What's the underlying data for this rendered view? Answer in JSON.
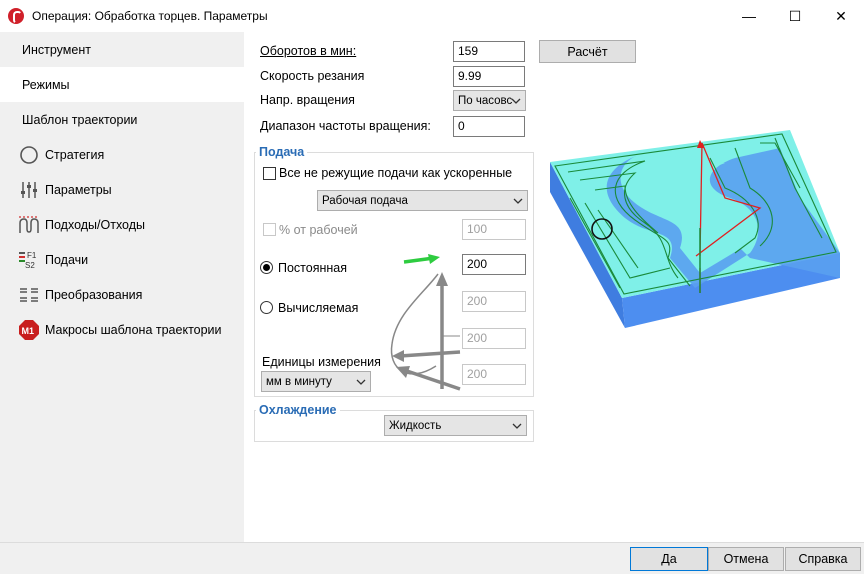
{
  "window": {
    "title": "Операция: Обработка торцев. Параметры",
    "min_glyph": "—",
    "max_glyph": "☐",
    "close_glyph": "✕"
  },
  "sidebar": {
    "items": [
      {
        "label": "Инструмент",
        "icon": null
      },
      {
        "label": "Режимы",
        "icon": null,
        "selected": true
      },
      {
        "label": "Шаблон траектории",
        "icon": null
      },
      {
        "label": "Стратегия",
        "icon": "compass-icon"
      },
      {
        "label": "Параметры",
        "icon": "sliders-icon"
      },
      {
        "label": "Подходы/Отходы",
        "icon": "approach-retract-icon"
      },
      {
        "label": "Подачи",
        "icon": "feeds-icon",
        "icon_text": "F1\nS2"
      },
      {
        "label": "Преобразования",
        "icon": "transform-icon"
      },
      {
        "label": "Макросы шаблона траектории",
        "icon": "macro-icon",
        "icon_text": "M1"
      }
    ]
  },
  "spindle": {
    "rpm_label": "Оборотов в мин:",
    "rpm_value": "159",
    "calc_button": "Расчёт",
    "cutting_speed_label": "Скорость резания",
    "cutting_speed_value": "9.99",
    "rotation_dir_label": "Напр. вращения",
    "rotation_dir_value": "По часовс",
    "freq_range_label": "Диапазон частоты вращения:",
    "freq_range_value": "0"
  },
  "feed": {
    "group_title": "Подача",
    "rapid_checkbox_label": "Все не режущие подачи как ускоренные",
    "feed_type_value": "Рабочая подача",
    "percent_label": "% от рабочей",
    "percent_value": "100",
    "constant_label": "Постоянная",
    "constant_value": "200",
    "computed_label": "Вычисляемая",
    "computed_values": [
      "200",
      "200",
      "200"
    ],
    "units_label": "Единицы измерения",
    "units_value": "мм в минуту"
  },
  "cooling": {
    "group_title": "Охлаждение",
    "value": "Жидкость"
  },
  "footer": {
    "ok": "Да",
    "cancel": "Отмена",
    "help": "Справка"
  },
  "colors": {
    "accent": "#2a6cb5",
    "part_top": "#7ff0e8",
    "part_side": "#4d8ef0",
    "toolpath": "#1a8a3a",
    "rapid": "#e02020"
  }
}
